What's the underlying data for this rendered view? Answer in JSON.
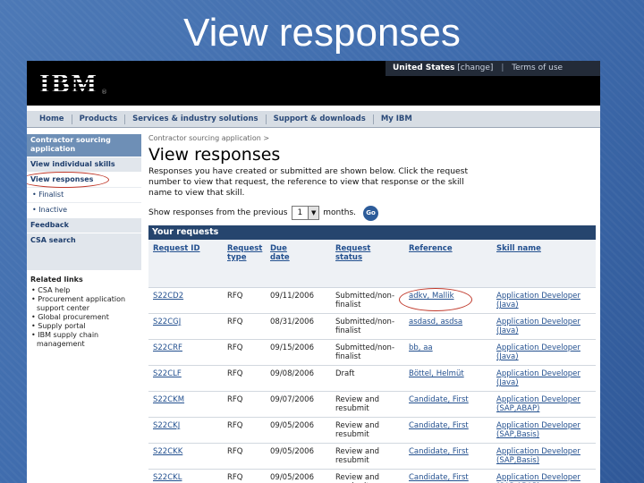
{
  "slide_title": "View responses",
  "masthead": {
    "logo": "IBM",
    "country": "United States",
    "change": "[change]",
    "separator": "|",
    "terms": "Terms of use"
  },
  "nav": [
    "Home",
    "Products",
    "Services & industry solutions",
    "Support & downloads",
    "My IBM"
  ],
  "left_nav": {
    "header": "Contractor sourcing application",
    "items": [
      "View individual skills",
      "View responses"
    ],
    "subitems": [
      "Finalist",
      "Inactive"
    ],
    "items2": [
      "Feedback",
      "CSA search"
    ]
  },
  "related": {
    "heading": "Related links",
    "links": [
      "CSA help",
      "Procurement application support center",
      "Global procurement",
      "Supply portal",
      "IBM supply chain management"
    ]
  },
  "breadcrumb": "Contractor sourcing application >",
  "page_title": "View responses",
  "intro": "Responses you have created or submitted are shown below. Click the request number to view that request, the reference to view that response or the skill name to view that skill.",
  "filter": {
    "before": "Show responses from the previous",
    "value": "1",
    "after": "months.",
    "go": "Go"
  },
  "table": {
    "title": "Your requests",
    "columns": [
      "Request ID",
      "Request type",
      "Due date",
      "Request status",
      "Reference",
      "Skill name"
    ],
    "rows": [
      [
        "S22CD2",
        "RFQ",
        "09/11/2006",
        "Submitted/non-finalist",
        "adkv, Mallik",
        "Application Developer (Java)"
      ],
      [
        "S22CGJ",
        "RFQ",
        "08/31/2006",
        "Submitted/non-finalist",
        "asdasd, asdsa",
        "Application Developer (Java)"
      ],
      [
        "S22CRF",
        "RFQ",
        "09/15/2006",
        "Submitted/non-finalist",
        "bb, aa",
        "Application Developer (Java)"
      ],
      [
        "S22CLF",
        "RFQ",
        "09/08/2006",
        "Draft",
        "Böttel, Helmüt",
        "Application Developer (Java)"
      ],
      [
        "S22CKM",
        "RFQ",
        "09/07/2006",
        "Review and resubmit",
        "Candidate, First",
        "Application Developer (SAP,ABAP)"
      ],
      [
        "S22CKJ",
        "RFQ",
        "09/05/2006",
        "Review and resubmit",
        "Candidate, First",
        "Application Developer (SAP,Basis)"
      ],
      [
        "S22CKK",
        "RFQ",
        "09/05/2006",
        "Review and resubmit",
        "Candidate, First",
        "Application Developer (SAP,Basis)"
      ],
      [
        "S22CKL",
        "RFQ",
        "09/05/2006",
        "Review and resubmit",
        "Candidate, First",
        "Application Developer (SAP,ABAP)"
      ]
    ]
  },
  "colors": {
    "accent": "#26456e",
    "link": "#23508f",
    "highlight": "#c0392b"
  }
}
